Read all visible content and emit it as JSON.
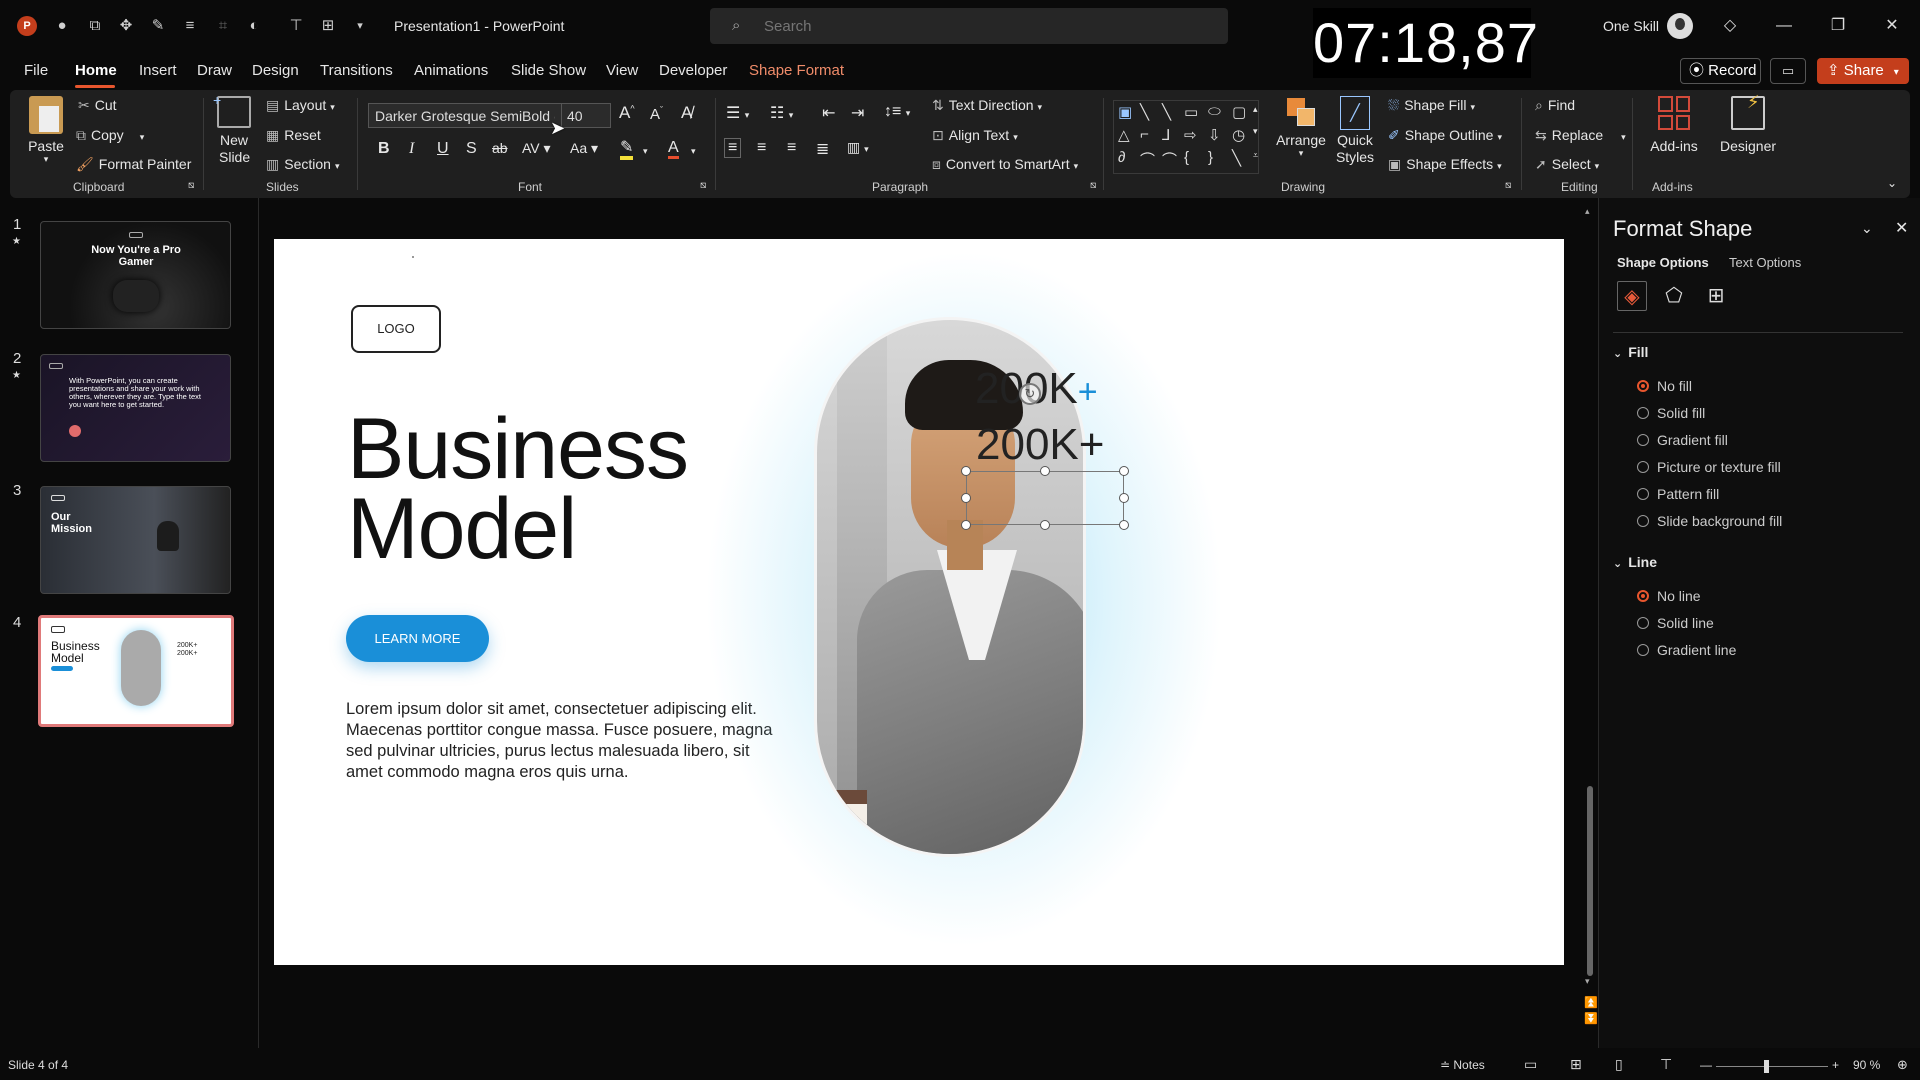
{
  "titlebar": {
    "app_icon": "P",
    "doc_title": "Presentation1  -  PowerPoint",
    "search_placeholder": "Search",
    "timer": "07:18,87",
    "user_name": "One Skill",
    "quick_access_icons": [
      "autosave-icon",
      "screenshot-icon",
      "draw-icon",
      "pen-icon",
      "align-icon",
      "crop-icon",
      "shape-icon",
      "distribute-icon",
      "group-icon",
      "more-icon"
    ]
  },
  "menu": {
    "tabs": [
      "File",
      "Home",
      "Insert",
      "Draw",
      "Design",
      "Transitions",
      "Animations",
      "Slide Show",
      "View",
      "Developer",
      "Shape Format"
    ],
    "record_label": "Record",
    "share_label": "Share"
  },
  "ribbon": {
    "clipboard": {
      "paste": "Paste",
      "cut": "Cut",
      "copy": "Copy",
      "format_painter": "Format Painter",
      "label": "Clipboard"
    },
    "slides": {
      "new_slide": "New Slide",
      "layout": "Layout",
      "reset": "Reset",
      "section": "Section",
      "label": "Slides"
    },
    "font": {
      "name": "Darker Grotesque SemiBold (",
      "size": "40",
      "label": "Font"
    },
    "paragraph": {
      "text_direction": "Text Direction",
      "align_text": "Align Text",
      "convert_smartart": "Convert to SmartArt",
      "label": "Paragraph"
    },
    "drawing": {
      "arrange": "Arrange",
      "quick_styles": "Quick Styles",
      "shape_fill": "Shape Fill",
      "shape_outline": "Shape Outline",
      "shape_effects": "Shape Effects",
      "label": "Drawing"
    },
    "editing": {
      "find": "Find",
      "replace": "Replace",
      "select": "Select",
      "label": "Editing"
    },
    "addins": {
      "addins": "Add-ins",
      "designer": "Designer",
      "label": "Add-ins"
    }
  },
  "thumbnails": [
    {
      "num": "1",
      "title": "Now You're a Pro Gamer"
    },
    {
      "num": "2",
      "title": "With PowerPoint, you can create presentations and share your work with others, wherever they are. Type the text you want here to get started."
    },
    {
      "num": "3",
      "title": "Our Mission"
    },
    {
      "num": "4",
      "title": "Business Model",
      "stat1": "200K+",
      "stat2": "200K+"
    }
  ],
  "slide": {
    "logo": "LOGO",
    "title_line1": "Business",
    "title_line2": "Model",
    "button": "LEARN MORE",
    "body": "Lorem ipsum dolor sit amet, consectetuer adipiscing elit. Maecenas porttitor congue massa. Fusce posuere, magna sed pulvinar ultricies, purus lectus malesuada libero, sit amet commodo magna eros quis urna.",
    "stat1_value": "200K",
    "stat1_plus": "+",
    "stat2_value": "200K+"
  },
  "format_pane": {
    "title": "Format Shape",
    "tab_shape": "Shape Options",
    "tab_text": "Text Options",
    "fill_header": "Fill",
    "fill_options": [
      "No fill",
      "Solid fill",
      "Gradient fill",
      "Picture or texture fill",
      "Pattern fill",
      "Slide background fill"
    ],
    "line_header": "Line",
    "line_options": [
      "No line",
      "Solid line",
      "Gradient line"
    ]
  },
  "status": {
    "slide_info": "Slide 4 of 4",
    "notes": "Notes",
    "zoom": "90 %"
  },
  "colors": {
    "accent": "#e8562e",
    "slide_button": "#1a8fd8",
    "share": "#c43e1c"
  }
}
